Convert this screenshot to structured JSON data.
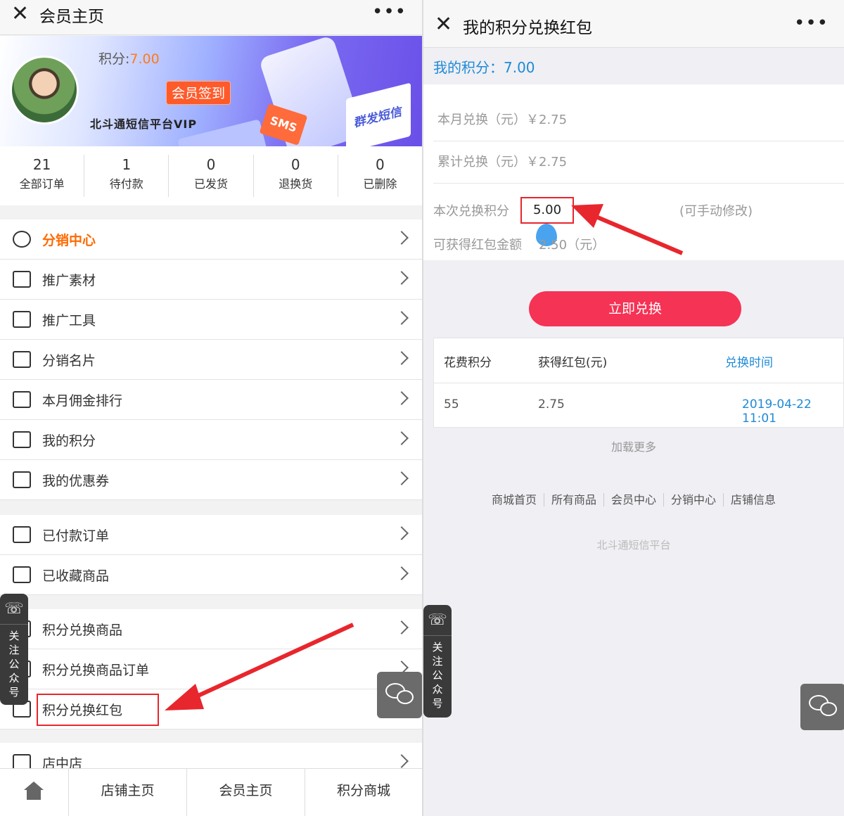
{
  "left": {
    "nav": {
      "title": "会员主页",
      "close": "✕",
      "more": "•••"
    },
    "banner": {
      "points_prefix": "积分:",
      "points_value": "7.00",
      "signin_label": "会员签到",
      "platform_name": "北斗通短信平台VIP",
      "sms_tag": "SMS",
      "cube_text": "群发短信"
    },
    "stats": [
      {
        "num": "21",
        "label": "全部订单"
      },
      {
        "num": "1",
        "label": "待付款"
      },
      {
        "num": "0",
        "label": "已发货"
      },
      {
        "num": "0",
        "label": "退换货"
      },
      {
        "num": "0",
        "label": "已删除"
      }
    ],
    "menu_group1": [
      {
        "label": "分销中心",
        "icon": "people-icon"
      },
      {
        "label": "推广素材",
        "icon": "list-icon"
      },
      {
        "label": "推广工具",
        "icon": "briefcase-icon"
      },
      {
        "label": "分销名片",
        "icon": "id-card-icon"
      },
      {
        "label": "本月佣金排行",
        "icon": "bar-chart-icon"
      },
      {
        "label": "我的积分",
        "icon": "list-icon"
      },
      {
        "label": "我的优惠券",
        "icon": "ticket-icon"
      }
    ],
    "menu_group2": [
      {
        "label": "已付款订单",
        "icon": "clipboard-icon"
      },
      {
        "label": "已收藏商品",
        "icon": "heart-icon"
      }
    ],
    "menu_group3": [
      {
        "label": "积分兑换商品",
        "icon": "gift-icon"
      },
      {
        "label": "积分兑换商品订单",
        "icon": "bag-icon"
      },
      {
        "label": "积分兑换红包",
        "icon": "vip-card-icon"
      }
    ],
    "menu_group4": [
      {
        "label": "店中店",
        "icon": "store-icon"
      }
    ],
    "tabbar": [
      "店铺主页",
      "会员主页",
      "积分商城"
    ],
    "follow": {
      "text": [
        "关",
        "注",
        "公",
        "众",
        "号"
      ]
    }
  },
  "right": {
    "nav": {
      "title": "我的积分兑换红包",
      "close": "✕",
      "more": "•••"
    },
    "my_points": "我的积分：7.00",
    "month_exchange": "本月兑换（元）￥2.75",
    "total_exchange": "累计兑换（元）￥2.75",
    "current_points_label": "本次兑换积分",
    "current_points_value": "5.00",
    "editable_hint": "(可手动修改)",
    "redpacket_label": "可获得红包金额",
    "redpacket_value": "2.50（元）",
    "redeem_button": "立即兑换",
    "table": {
      "headers": [
        "花费积分",
        "获得红包(元)",
        "兑换时间"
      ],
      "rows": [
        [
          "55",
          "2.75",
          "2019-04-22 11:01"
        ]
      ]
    },
    "load_more": "加载更多",
    "footer_links": [
      "商城首页",
      "所有商品",
      "会员中心",
      "分销中心",
      "店铺信息"
    ],
    "footer_brand": "北斗通短信平台"
  },
  "colors": {
    "accent_red": "#f53355",
    "link_blue": "#1f8ad6",
    "orange": "#ff6a00",
    "annotation_red": "#e8262d"
  }
}
